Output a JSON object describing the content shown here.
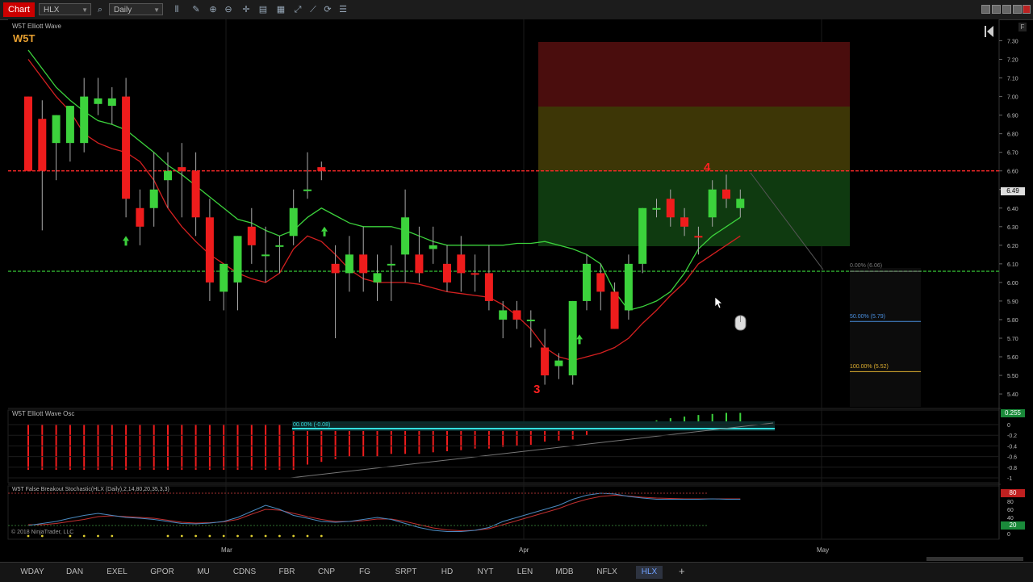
{
  "toolbar": {
    "chart_tab": "Chart",
    "symbol": "HLX",
    "interval": "Daily",
    "icons": [
      "search-icon",
      "bar-style-icon",
      "pencil-icon",
      "zoom-in-icon",
      "zoom-out-icon",
      "crosshair-icon",
      "properties-icon",
      "strategy-icon",
      "indicators-icon",
      "drawing-tools-icon",
      "refresh-icon",
      "list-icon"
    ]
  },
  "chart": {
    "panel_title": "W5T Elliott Wave",
    "logo": "W5T",
    "osc_title": "W5T Elliott Wave Osc",
    "stoch_title": "W5T False Breakout Stochastic(HLX (Daily),2,14,80,20,35,3,3)",
    "copyright": "© 2018 NinjaTrader, LLC",
    "wave_labels": {
      "w3": "3",
      "w4": "4"
    },
    "fib_labels": [
      "0.00% (6.06)",
      "50.00% (5.79)",
      "100.00% (5.52)"
    ],
    "osc_fib_label": "00.00% (-0.08)",
    "price_badge": "6.49",
    "osc_badge": "0.255",
    "stoch_badges": [
      "80",
      "20"
    ],
    "f_button": "F",
    "x_labels": [
      "Mar",
      "Apr",
      "May"
    ],
    "price_ticks": [
      "7.30",
      "7.20",
      "7.10",
      "7.00",
      "6.90",
      "6.80",
      "6.70",
      "6.60",
      "6.50",
      "6.40",
      "6.30",
      "6.20",
      "6.10",
      "6.00",
      "5.90",
      "5.80",
      "5.70",
      "5.60",
      "5.50",
      "5.40"
    ],
    "osc_ticks": [
      "0",
      "-0.2",
      "-0.4",
      "-0.6",
      "-0.8",
      "-1"
    ],
    "stoch_ticks": [
      "80",
      "60",
      "40",
      "20",
      "0"
    ],
    "colors": {
      "up": "#3cd23c",
      "down": "#ee1c1c",
      "fast_ma": "#3cd23c",
      "slow_ma": "#d42020",
      "level_red": "#ff2a2a",
      "level_green": "#2fae2f"
    }
  },
  "chart_data": {
    "type": "candlestick",
    "x_labels": [
      "Mar",
      "Apr",
      "May"
    ],
    "ylim": [
      5.35,
      7.35
    ],
    "candles": [
      {
        "o": 6.6,
        "h": 6.9,
        "l": 6.6,
        "c": 7.0,
        "d": "down"
      },
      {
        "o": 6.88,
        "h": 6.98,
        "l": 6.28,
        "c": 6.6,
        "d": "down"
      },
      {
        "o": 6.75,
        "h": 6.9,
        "l": 6.55,
        "c": 6.9,
        "d": "up"
      },
      {
        "o": 6.75,
        "h": 6.95,
        "l": 6.65,
        "c": 6.95,
        "d": "up"
      },
      {
        "o": 6.75,
        "h": 7.1,
        "l": 6.7,
        "c": 7.0,
        "d": "up"
      },
      {
        "o": 6.96,
        "h": 7.1,
        "l": 6.9,
        "c": 6.99,
        "d": "up"
      },
      {
        "o": 6.95,
        "h": 7.05,
        "l": 6.85,
        "c": 6.99,
        "d": "up"
      },
      {
        "o": 7.0,
        "h": 7.1,
        "l": 6.35,
        "c": 6.45,
        "d": "down"
      },
      {
        "o": 6.4,
        "h": 6.5,
        "l": 6.2,
        "c": 6.3,
        "d": "down"
      },
      {
        "o": 6.4,
        "h": 6.7,
        "l": 6.3,
        "c": 6.5,
        "d": "up"
      },
      {
        "o": 6.55,
        "h": 6.7,
        "l": 6.4,
        "c": 6.6,
        "d": "up"
      },
      {
        "o": 6.62,
        "h": 6.75,
        "l": 6.35,
        "c": 6.6,
        "d": "down"
      },
      {
        "o": 6.6,
        "h": 6.7,
        "l": 6.25,
        "c": 6.35,
        "d": "down"
      },
      {
        "o": 6.35,
        "h": 6.45,
        "l": 5.9,
        "c": 6.0,
        "d": "down"
      },
      {
        "o": 5.95,
        "h": 6.1,
        "l": 5.85,
        "c": 6.1,
        "d": "up"
      },
      {
        "o": 6.0,
        "h": 6.25,
        "l": 5.85,
        "c": 6.25,
        "d": "up"
      },
      {
        "o": 6.3,
        "h": 6.4,
        "l": 6.1,
        "c": 6.2,
        "d": "down"
      },
      {
        "o": 6.15,
        "h": 6.3,
        "l": 6.0,
        "c": 6.15,
        "d": "up"
      },
      {
        "o": 6.2,
        "h": 6.25,
        "l": 6.05,
        "c": 6.2,
        "d": "up"
      },
      {
        "o": 6.25,
        "h": 6.5,
        "l": 6.2,
        "c": 6.4,
        "d": "up"
      },
      {
        "o": 6.5,
        "h": 6.7,
        "l": 6.45,
        "c": 6.5,
        "d": "up"
      },
      {
        "o": 6.6,
        "h": 6.65,
        "l": 6.55,
        "c": 6.62,
        "d": "down"
      },
      {
        "o": 6.1,
        "h": 6.2,
        "l": 5.7,
        "c": 6.05,
        "d": "down"
      },
      {
        "o": 6.05,
        "h": 6.25,
        "l": 5.95,
        "c": 6.15,
        "d": "up"
      },
      {
        "o": 6.15,
        "h": 6.3,
        "l": 5.95,
        "c": 6.05,
        "d": "down"
      },
      {
        "o": 6.05,
        "h": 6.15,
        "l": 5.9,
        "c": 6.0,
        "d": "up"
      },
      {
        "o": 6.1,
        "h": 6.2,
        "l": 5.9,
        "c": 6.1,
        "d": "up"
      },
      {
        "o": 6.15,
        "h": 6.5,
        "l": 6.0,
        "c": 6.35,
        "d": "up"
      },
      {
        "o": 6.15,
        "h": 6.3,
        "l": 6.0,
        "c": 6.05,
        "d": "down"
      },
      {
        "o": 6.18,
        "h": 6.3,
        "l": 6.1,
        "c": 6.2,
        "d": "up"
      },
      {
        "o": 6.1,
        "h": 6.2,
        "l": 5.95,
        "c": 6.0,
        "d": "down"
      },
      {
        "o": 6.15,
        "h": 6.25,
        "l": 5.95,
        "c": 6.05,
        "d": "down"
      },
      {
        "o": 6.05,
        "h": 6.15,
        "l": 5.95,
        "c": 6.05,
        "d": "down"
      },
      {
        "o": 6.05,
        "h": 6.2,
        "l": 5.85,
        "c": 5.9,
        "d": "down"
      },
      {
        "o": 5.8,
        "h": 5.9,
        "l": 5.7,
        "c": 5.85,
        "d": "up"
      },
      {
        "o": 5.85,
        "h": 5.9,
        "l": 5.75,
        "c": 5.8,
        "d": "down"
      },
      {
        "o": 5.8,
        "h": 5.85,
        "l": 5.65,
        "c": 5.8,
        "d": "up"
      },
      {
        "o": 5.65,
        "h": 5.75,
        "l": 5.45,
        "c": 5.5,
        "d": "down"
      },
      {
        "o": 5.55,
        "h": 5.62,
        "l": 5.48,
        "c": 5.58,
        "d": "up"
      },
      {
        "o": 5.5,
        "h": 5.9,
        "l": 5.45,
        "c": 5.9,
        "d": "up"
      },
      {
        "o": 5.9,
        "h": 6.15,
        "l": 5.85,
        "c": 6.1,
        "d": "up"
      },
      {
        "o": 6.05,
        "h": 6.1,
        "l": 5.85,
        "c": 5.95,
        "d": "down"
      },
      {
        "o": 5.95,
        "h": 6.0,
        "l": 5.75,
        "c": 5.75,
        "d": "down"
      },
      {
        "o": 5.85,
        "h": 6.15,
        "l": 5.8,
        "c": 6.1,
        "d": "up"
      },
      {
        "o": 6.1,
        "h": 6.4,
        "l": 6.05,
        "c": 6.4,
        "d": "up"
      },
      {
        "o": 6.4,
        "h": 6.45,
        "l": 6.35,
        "c": 6.4,
        "d": "up"
      },
      {
        "o": 6.45,
        "h": 6.5,
        "l": 6.3,
        "c": 6.35,
        "d": "down"
      },
      {
        "o": 6.35,
        "h": 6.4,
        "l": 6.25,
        "c": 6.3,
        "d": "down"
      },
      {
        "o": 6.25,
        "h": 6.3,
        "l": 6.15,
        "c": 6.25,
        "d": "down"
      },
      {
        "o": 6.35,
        "h": 6.55,
        "l": 6.3,
        "c": 6.5,
        "d": "up"
      },
      {
        "o": 6.5,
        "h": 6.58,
        "l": 6.4,
        "c": 6.45,
        "d": "down"
      },
      {
        "o": 6.4,
        "h": 6.5,
        "l": 6.35,
        "c": 6.45,
        "d": "up"
      }
    ],
    "fast_ma": [
      7.25,
      7.15,
      7.05,
      6.98,
      6.92,
      6.87,
      6.85,
      6.82,
      6.76,
      6.7,
      6.63,
      6.58,
      6.52,
      6.46,
      6.4,
      6.34,
      6.32,
      6.28,
      6.25,
      6.28,
      6.35,
      6.4,
      6.36,
      6.32,
      6.3,
      6.3,
      6.3,
      6.28,
      6.25,
      6.22,
      6.2,
      6.2,
      6.2,
      6.2,
      6.2,
      6.21,
      6.21,
      6.22,
      6.2,
      6.18,
      6.15,
      6.1,
      5.95,
      5.85,
      5.87,
      5.9,
      5.95,
      6.05,
      6.18,
      6.25,
      6.3,
      6.35
    ],
    "slow_ma": [
      7.2,
      7.1,
      7.0,
      6.92,
      6.8,
      6.75,
      6.72,
      6.7,
      6.65,
      6.55,
      6.4,
      6.3,
      6.22,
      6.15,
      6.1,
      6.05,
      6.02,
      6.0,
      6.05,
      6.18,
      6.25,
      6.22,
      6.15,
      6.07,
      6.02,
      6.0,
      6.0,
      6.0,
      5.99,
      5.97,
      5.95,
      5.94,
      5.93,
      5.92,
      5.88,
      5.82,
      5.75,
      5.65,
      5.6,
      5.58,
      5.6,
      5.62,
      5.65,
      5.7,
      5.78,
      5.85,
      5.93,
      6.0,
      6.1,
      6.15,
      6.2,
      6.25
    ],
    "levels": {
      "resistance": 6.6,
      "support": 6.06
    },
    "fib": {
      "p0": 6.06,
      "p50": 5.79,
      "p100": 5.52
    },
    "osc": [
      -0.85,
      -0.85,
      -0.85,
      -0.85,
      -0.85,
      -0.85,
      -0.85,
      -0.85,
      -0.85,
      -0.85,
      -0.85,
      -0.85,
      -0.85,
      -0.85,
      -0.85,
      -0.85,
      -0.85,
      -0.85,
      -0.85,
      -0.85,
      -0.75,
      -0.7,
      -0.65,
      -0.6,
      -0.6,
      -0.6,
      -0.55,
      -0.55,
      -0.55,
      -0.52,
      -0.5,
      -0.48,
      -0.45,
      -0.45,
      -0.42,
      -0.4,
      -0.38,
      -0.32,
      -0.3,
      -0.28,
      -0.2,
      -0.12,
      0.0,
      0.0,
      0.05,
      0.08,
      0.12,
      0.15,
      0.18,
      0.2,
      0.22,
      0.22
    ],
    "stoch_fast": [
      20,
      25,
      30,
      38,
      45,
      50,
      45,
      40,
      38,
      35,
      30,
      25,
      24,
      26,
      30,
      40,
      55,
      70,
      60,
      45,
      38,
      30,
      28,
      30,
      35,
      40,
      35,
      25,
      15,
      8,
      5,
      5,
      8,
      15,
      30,
      40,
      50,
      60,
      70,
      85,
      95,
      100,
      98,
      92,
      88,
      85,
      85,
      85,
      85,
      86,
      85,
      85
    ],
    "stoch_slow": [
      22,
      22,
      25,
      30,
      35,
      42,
      44,
      42,
      40,
      38,
      33,
      28,
      26,
      27,
      29,
      35,
      48,
      60,
      58,
      50,
      42,
      35,
      30,
      30,
      32,
      36,
      36,
      30,
      22,
      14,
      9,
      7,
      8,
      12,
      22,
      32,
      42,
      52,
      62,
      75,
      85,
      92,
      95,
      93,
      90,
      88,
      87,
      86,
      86,
      86,
      86,
      86
    ]
  },
  "symbols": [
    "WDAY",
    "DAN",
    "EXEL",
    "GPOR",
    "MU",
    "CDNS",
    "FBR",
    "CNP",
    "FG",
    "SRPT",
    "HD",
    "NYT",
    "LEN",
    "MDB",
    "NFLX",
    "HLX"
  ],
  "active_symbol": "HLX"
}
